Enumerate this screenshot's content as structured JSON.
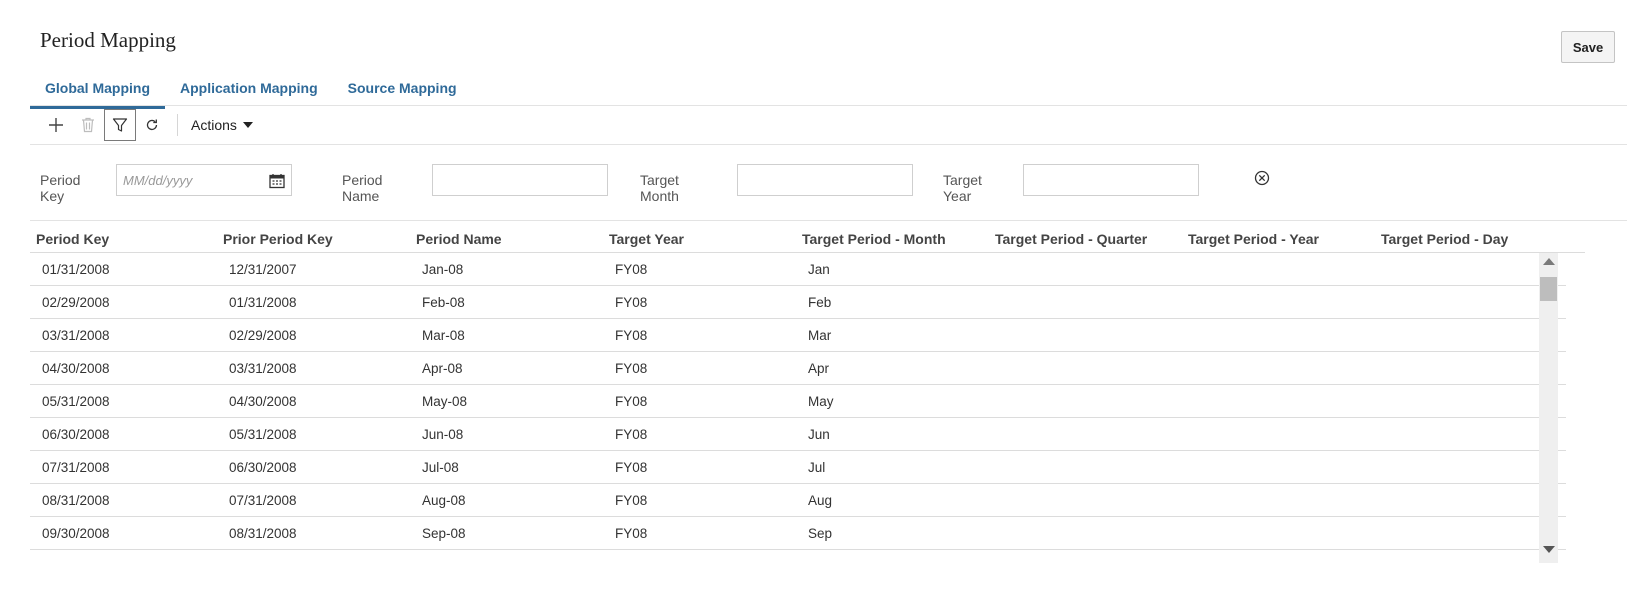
{
  "page": {
    "title": "Period Mapping"
  },
  "header": {
    "save_label": "Save"
  },
  "tabs": [
    {
      "label": "Global Mapping",
      "active": true
    },
    {
      "label": "Application Mapping",
      "active": false
    },
    {
      "label": "Source Mapping",
      "active": false
    }
  ],
  "toolbar": {
    "add_icon": "plus-icon",
    "delete_icon": "trash-icon",
    "filter_icon": "filter-icon",
    "refresh_icon": "refresh-icon",
    "actions_label": "Actions"
  },
  "filters": {
    "period_key_label": "Period Key",
    "period_key_placeholder": "MM/dd/yyyy",
    "period_name_label": "Period Name",
    "target_month_label": "Target Month",
    "target_year_label": "Target Year"
  },
  "table": {
    "columns": [
      "Period Key",
      "Prior Period Key",
      "Period Name",
      "Target Year",
      "Target Period - Month",
      "Target Period - Quarter",
      "Target Period - Year",
      "Target Period - Day"
    ],
    "rows": [
      [
        "01/31/2008",
        "12/31/2007",
        "Jan-08",
        "FY08",
        "Jan",
        "",
        "",
        ""
      ],
      [
        "02/29/2008",
        "01/31/2008",
        "Feb-08",
        "FY08",
        "Feb",
        "",
        "",
        ""
      ],
      [
        "03/31/2008",
        "02/29/2008",
        "Mar-08",
        "FY08",
        "Mar",
        "",
        "",
        ""
      ],
      [
        "04/30/2008",
        "03/31/2008",
        "Apr-08",
        "FY08",
        "Apr",
        "",
        "",
        ""
      ],
      [
        "05/31/2008",
        "04/30/2008",
        "May-08",
        "FY08",
        "May",
        "",
        "",
        ""
      ],
      [
        "06/30/2008",
        "05/31/2008",
        "Jun-08",
        "FY08",
        "Jun",
        "",
        "",
        ""
      ],
      [
        "07/31/2008",
        "06/30/2008",
        "Jul-08",
        "FY08",
        "Jul",
        "",
        "",
        ""
      ],
      [
        "08/31/2008",
        "07/31/2008",
        "Aug-08",
        "FY08",
        "Aug",
        "",
        "",
        ""
      ],
      [
        "09/30/2008",
        "08/31/2008",
        "Sep-08",
        "FY08",
        "Sep",
        "",
        "",
        ""
      ]
    ]
  },
  "colors": {
    "accent": "#2f6a99",
    "border": "#dcdcdc"
  }
}
